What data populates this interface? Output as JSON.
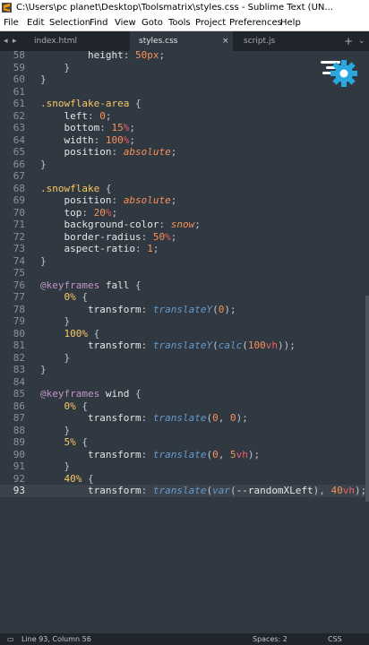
{
  "window": {
    "title": "C:\\Users\\pc planet\\Desktop\\Toolsmatrix\\styles.css - Sublime Text (UN...",
    "minimize": "—",
    "maximize": "□"
  },
  "menu": [
    "File",
    "Edit",
    "Selection",
    "Find",
    "View",
    "Goto",
    "Tools",
    "Project",
    "Preferences",
    "Help"
  ],
  "tabs": [
    {
      "label": "index.html",
      "active": false
    },
    {
      "label": "styles.css",
      "active": true,
      "close": "×"
    },
    {
      "label": "script.js",
      "active": false
    }
  ],
  "nav": {
    "left": "◂",
    "right": "▸",
    "add": "+",
    "overflow": "⌄"
  },
  "colors": {
    "background": "#303841",
    "selector": "#fac863",
    "value": "#f99157",
    "unit": "#ec5f67",
    "function": "#6699cc",
    "at_rule": "#c594c5",
    "gear": "#29a8e0"
  },
  "icons": {
    "gear": "gear-icon",
    "app": "sublime-logo-icon"
  },
  "editor": {
    "lines": [
      {
        "n": "58",
        "t": [
          [
            "prop",
            "        height"
          ],
          [
            "punc",
            ": "
          ],
          [
            "num",
            "50px"
          ],
          [
            "punc",
            ";"
          ]
        ]
      },
      {
        "n": "59",
        "t": [
          [
            "punc",
            "    }"
          ]
        ]
      },
      {
        "n": "60",
        "t": [
          [
            "punc",
            "}"
          ]
        ]
      },
      {
        "n": "61",
        "t": []
      },
      {
        "n": "61",
        "t": [
          [
            "sel",
            ".snowflake-area"
          ],
          [
            "punc",
            " {"
          ]
        ]
      },
      {
        "n": "62",
        "t": [
          [
            "prop",
            "    left"
          ],
          [
            "punc",
            ": "
          ],
          [
            "num",
            "0"
          ],
          [
            "punc",
            ";"
          ]
        ]
      },
      {
        "n": "63",
        "t": [
          [
            "prop",
            "    bottom"
          ],
          [
            "punc",
            ": "
          ],
          [
            "num",
            "15"
          ],
          [
            "unit",
            "%"
          ],
          [
            "punc",
            ";"
          ]
        ]
      },
      {
        "n": "64",
        "t": [
          [
            "prop",
            "    width"
          ],
          [
            "punc",
            ": "
          ],
          [
            "num",
            "100"
          ],
          [
            "unit",
            "%"
          ],
          [
            "punc",
            ";"
          ]
        ]
      },
      {
        "n": "65",
        "t": [
          [
            "prop",
            "    position"
          ],
          [
            "punc",
            ": "
          ],
          [
            "val",
            "absolute"
          ],
          [
            "punc",
            ";"
          ]
        ]
      },
      {
        "n": "66",
        "t": [
          [
            "punc",
            "}"
          ]
        ]
      },
      {
        "n": "67",
        "t": []
      },
      {
        "n": "68",
        "t": [
          [
            "sel",
            ".snowflake"
          ],
          [
            "punc",
            " {"
          ]
        ]
      },
      {
        "n": "69",
        "t": [
          [
            "prop",
            "    position"
          ],
          [
            "punc",
            ": "
          ],
          [
            "val",
            "absolute"
          ],
          [
            "punc",
            ";"
          ]
        ]
      },
      {
        "n": "70",
        "t": [
          [
            "prop",
            "    top"
          ],
          [
            "punc",
            ": "
          ],
          [
            "num",
            "20"
          ],
          [
            "unit",
            "%"
          ],
          [
            "punc",
            ";"
          ]
        ]
      },
      {
        "n": "71",
        "t": [
          [
            "prop",
            "    background-color"
          ],
          [
            "punc",
            ": "
          ],
          [
            "val",
            "snow"
          ],
          [
            "punc",
            ";"
          ]
        ]
      },
      {
        "n": "72",
        "t": [
          [
            "prop",
            "    border-radius"
          ],
          [
            "punc",
            ": "
          ],
          [
            "num",
            "50"
          ],
          [
            "unit",
            "%"
          ],
          [
            "punc",
            ";"
          ]
        ]
      },
      {
        "n": "73",
        "t": [
          [
            "prop",
            "    aspect-ratio"
          ],
          [
            "punc",
            ": "
          ],
          [
            "num",
            "1"
          ],
          [
            "punc",
            ";"
          ]
        ]
      },
      {
        "n": "74",
        "t": [
          [
            "punc",
            "}"
          ]
        ]
      },
      {
        "n": "75",
        "t": []
      },
      {
        "n": "76",
        "t": [
          [
            "at",
            "@keyframes"
          ],
          [
            "ident",
            " fall"
          ],
          [
            "punc",
            " {"
          ]
        ]
      },
      {
        "n": "77",
        "t": [
          [
            "pct",
            "    0%"
          ],
          [
            "punc",
            " {"
          ]
        ]
      },
      {
        "n": "78",
        "t": [
          [
            "prop",
            "        transform"
          ],
          [
            "punc",
            ": "
          ],
          [
            "fn",
            "translateY"
          ],
          [
            "punc",
            "("
          ],
          [
            "num",
            "0"
          ],
          [
            "punc",
            ");"
          ]
        ]
      },
      {
        "n": "79",
        "t": [
          [
            "punc",
            "    }"
          ]
        ]
      },
      {
        "n": "80",
        "t": [
          [
            "pct",
            "    100%"
          ],
          [
            "punc",
            " {"
          ]
        ]
      },
      {
        "n": "81",
        "t": [
          [
            "prop",
            "        transform"
          ],
          [
            "punc",
            ": "
          ],
          [
            "fn",
            "translateY"
          ],
          [
            "punc",
            "("
          ],
          [
            "fn",
            "calc"
          ],
          [
            "punc",
            "("
          ],
          [
            "num",
            "100"
          ],
          [
            "unit",
            "vh"
          ],
          [
            "punc",
            "));"
          ]
        ]
      },
      {
        "n": "82",
        "t": [
          [
            "punc",
            "    }"
          ]
        ]
      },
      {
        "n": "83",
        "t": [
          [
            "punc",
            "}"
          ]
        ]
      },
      {
        "n": "84",
        "t": []
      },
      {
        "n": "85",
        "t": [
          [
            "at",
            "@keyframes"
          ],
          [
            "ident",
            " wind"
          ],
          [
            "punc",
            " {"
          ]
        ]
      },
      {
        "n": "86",
        "t": [
          [
            "pct",
            "    0%"
          ],
          [
            "punc",
            " {"
          ]
        ]
      },
      {
        "n": "87",
        "t": [
          [
            "prop",
            "        transform"
          ],
          [
            "punc",
            ": "
          ],
          [
            "fn",
            "translate"
          ],
          [
            "punc",
            "("
          ],
          [
            "num",
            "0"
          ],
          [
            "punc",
            ", "
          ],
          [
            "num",
            "0"
          ],
          [
            "punc",
            ");"
          ]
        ]
      },
      {
        "n": "88",
        "t": [
          [
            "punc",
            "    }"
          ]
        ]
      },
      {
        "n": "89",
        "t": [
          [
            "pct",
            "    5%"
          ],
          [
            "punc",
            " {"
          ]
        ]
      },
      {
        "n": "90",
        "t": [
          [
            "prop",
            "        transform"
          ],
          [
            "punc",
            ": "
          ],
          [
            "fn",
            "translate"
          ],
          [
            "punc",
            "("
          ],
          [
            "num",
            "0"
          ],
          [
            "punc",
            ", "
          ],
          [
            "num",
            "5"
          ],
          [
            "unit",
            "vh"
          ],
          [
            "punc",
            ");"
          ]
        ]
      },
      {
        "n": "91",
        "t": [
          [
            "punc",
            "    }"
          ]
        ]
      },
      {
        "n": "92",
        "t": [
          [
            "pct",
            "    40%"
          ],
          [
            "punc",
            " {"
          ]
        ]
      },
      {
        "n": "93",
        "t": [
          [
            "prop",
            "        transform"
          ],
          [
            "punc",
            ": "
          ],
          [
            "fn",
            "translate"
          ],
          [
            "punc",
            "("
          ],
          [
            "fn",
            "var"
          ],
          [
            "punc",
            "("
          ],
          [
            "ident",
            "--randomXLeft"
          ],
          [
            "punc",
            "), "
          ],
          [
            "num",
            "40"
          ],
          [
            "unit",
            "vh"
          ],
          [
            "punc",
            ");"
          ]
        ],
        "current": true
      }
    ]
  },
  "status": {
    "position": "Line 93, Column 56",
    "indent": "Spaces: 2",
    "syntax": "CSS"
  }
}
